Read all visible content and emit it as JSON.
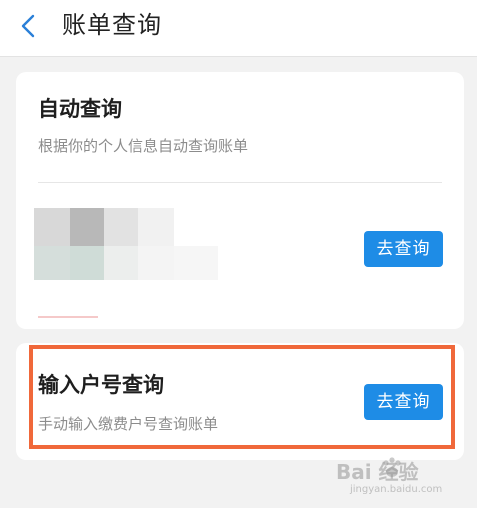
{
  "header": {
    "title": "账单查询"
  },
  "auto_query": {
    "title": "自动查询",
    "subtitle": "根据你的个人信息自动查询账单",
    "button_label": "去查询"
  },
  "manual_query": {
    "title": "输入户号查询",
    "subtitle": "手动输入缴费户号查询账单",
    "button_label": "去查询"
  },
  "watermark": {
    "logo": "Bai 经验",
    "site": "jingyan.baidu.com"
  },
  "colors": {
    "accent": "#1e8ce6",
    "highlight": "#f0683a",
    "background": "#f2f2f2"
  }
}
